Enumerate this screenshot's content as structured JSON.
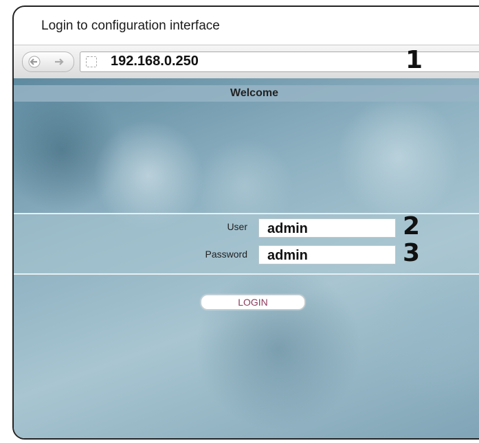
{
  "caption": "Login to configuration interface",
  "browser": {
    "url": "192.168.0.250",
    "back_icon": "back-arrow-icon",
    "forward_icon": "forward-arrow-icon",
    "page_icon": "blank-page-icon"
  },
  "page": {
    "welcome": "Welcome",
    "user_label": "User",
    "user_value": "admin",
    "password_label": "Password",
    "password_value": "admin",
    "login_label": "LOGIN"
  },
  "markers": {
    "url": "1",
    "user": "2",
    "password": "3"
  }
}
